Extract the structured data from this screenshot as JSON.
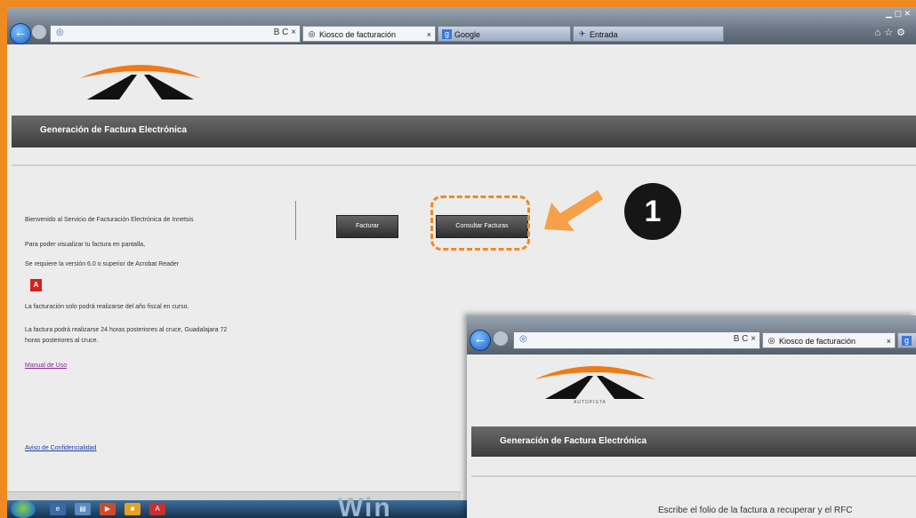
{
  "browser": {
    "tabs": [
      {
        "label": "Kiosco de facturación",
        "active": true,
        "close": "×"
      },
      {
        "label": "Google",
        "active": false
      },
      {
        "label": "Entrada",
        "active": false
      }
    ],
    "address_controls": "B C ×",
    "back_glyph": "←"
  },
  "page": {
    "header_title": "Generación de Factura Electrónica",
    "paragraphs": [
      "Bienvenido al Servicio de Facturación Electrónica de Innetsis",
      "Para poder visualizar tu factura en pantalla,",
      "Se requiere la versión 6.0 o superior de Acrobat Reader",
      "La facturación solo podrá realizarse del año fiscal en curso.",
      "La factura podrá realizarse 24 horas posteriores al cruce, Guadalajara 72",
      "horas posteriores al cruce."
    ],
    "pdf_icon_glyph": "A",
    "buttons": {
      "facturar": "Facturar",
      "consultar": "Consultar Facturas"
    },
    "links": {
      "manual": "Manual de Uso",
      "aviso": "Aviso de Confidencialidad"
    }
  },
  "annotation": {
    "step_number": "1",
    "highlight_color": "#f08a23"
  },
  "taskbar": {
    "watermark": "Win"
  },
  "second_window": {
    "tab_label": "Kiosco de facturación",
    "address_controls": "B C ×",
    "logo_subtitle": "AUTOPISTA",
    "header_title": "Generación de Factura Electrónica",
    "prompt": "Escribe el folio de la factura a recuperar y el RFC"
  },
  "colors": {
    "frame": "#ee8a22",
    "header_bar": "#4a4a4a",
    "logo_orange": "#f07a16",
    "link": "#1a3ea8"
  }
}
